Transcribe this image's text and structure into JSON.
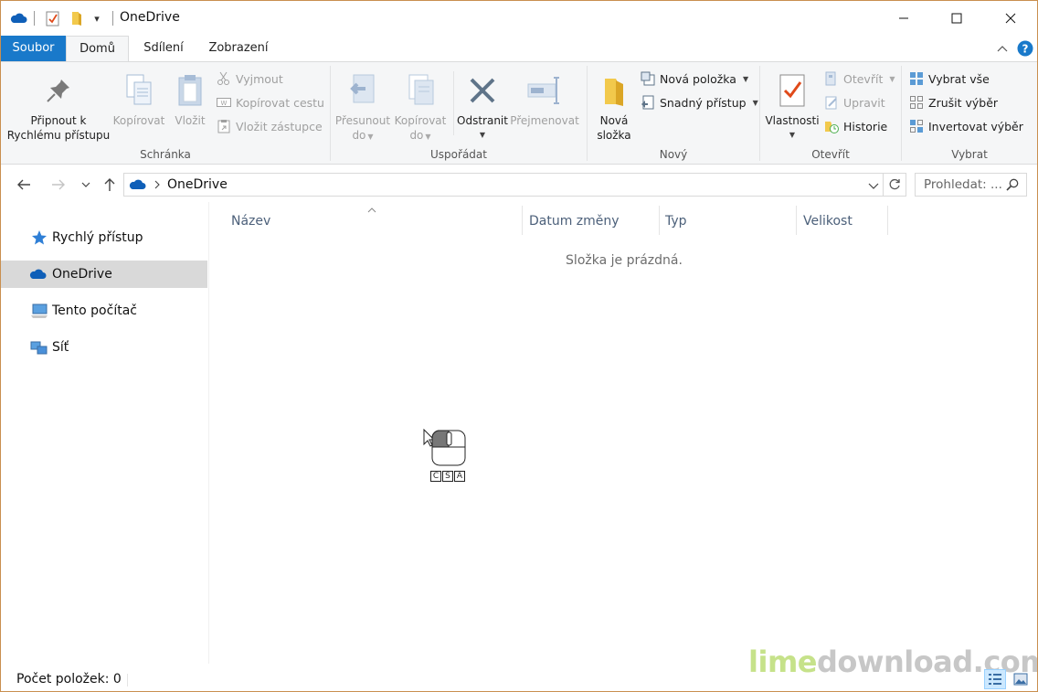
{
  "titlebar": {
    "title": "OneDrive",
    "qat_dropdown_glyph": "▾"
  },
  "tabs": [
    {
      "label": "Soubor"
    },
    {
      "label": "Domů"
    },
    {
      "label": "Sdílení"
    },
    {
      "label": "Zobrazení"
    }
  ],
  "ribbon": {
    "clipboard": {
      "label": "Schránka",
      "pin_line1": "Připnout k",
      "pin_line2": "Rychlému přístupu",
      "copy": "Kopírovat",
      "paste": "Vložit",
      "cut": "Vyjmout",
      "copy_path": "Kopírovat cestu",
      "paste_shortcut": "Vložit zástupce"
    },
    "organize": {
      "label": "Uspořádat",
      "move_line1": "Přesunout",
      "move_line2": "do",
      "copyto_line1": "Kopírovat",
      "copyto_line2": "do",
      "delete": "Odstranit",
      "rename": "Přejmenovat"
    },
    "new": {
      "label": "Nový",
      "newfolder_line1": "Nová",
      "newfolder_line2": "složka",
      "new_item": "Nová položka",
      "easy_access": "Snadný přístup"
    },
    "open": {
      "label": "Otevřít",
      "properties": "Vlastnosti",
      "open": "Otevřít",
      "edit": "Upravit",
      "history": "Historie"
    },
    "select": {
      "label": "Vybrat",
      "select_all": "Vybrat vše",
      "select_none": "Zrušit výběr",
      "invert": "Invertovat výběr"
    }
  },
  "address": {
    "crumb": "OneDrive",
    "search_placeholder": "Prohledat: ..."
  },
  "navpane": {
    "items": [
      {
        "label": "Rychlý přístup"
      },
      {
        "label": "OneDrive"
      },
      {
        "label": "Tento počítač"
      },
      {
        "label": "Síť"
      }
    ]
  },
  "content": {
    "columns": [
      "Název",
      "Datum změny",
      "Typ",
      "Velikost"
    ],
    "empty_text": "Složka je prázdná."
  },
  "statusbar": {
    "text": "Počet položek: 0"
  },
  "watermark": {
    "part1": "lime",
    "part2": "download.com"
  },
  "mouse_widget": {
    "keys": [
      "C",
      "S",
      "A"
    ]
  },
  "colors": {
    "file_tab": "#1979ca",
    "onedrive_blue": "#0f5fb8",
    "selected_nav": "#d9d9d9",
    "column_header_text": "#4c607a"
  }
}
